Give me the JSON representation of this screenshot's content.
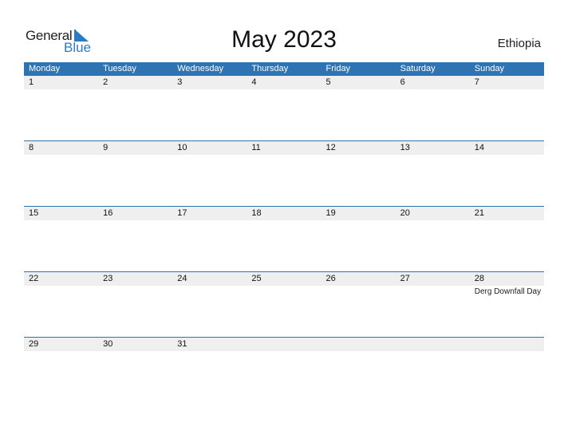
{
  "logo": {
    "general": "General",
    "blue": "Blue"
  },
  "title": "May 2023",
  "country": "Ethiopia",
  "colors": {
    "accent": "#2e73b3",
    "row_bg": "#efefef",
    "logo_blue": "#2a7bc4"
  },
  "weekdays": [
    "Monday",
    "Tuesday",
    "Wednesday",
    "Thursday",
    "Friday",
    "Saturday",
    "Sunday"
  ],
  "weeks": [
    {
      "days": [
        "1",
        "2",
        "3",
        "4",
        "5",
        "6",
        "7"
      ],
      "events": [
        "",
        "",
        "",
        "",
        "",
        "",
        ""
      ]
    },
    {
      "days": [
        "8",
        "9",
        "10",
        "11",
        "12",
        "13",
        "14"
      ],
      "events": [
        "",
        "",
        "",
        "",
        "",
        "",
        ""
      ]
    },
    {
      "days": [
        "15",
        "16",
        "17",
        "18",
        "19",
        "20",
        "21"
      ],
      "events": [
        "",
        "",
        "",
        "",
        "",
        "",
        ""
      ]
    },
    {
      "days": [
        "22",
        "23",
        "24",
        "25",
        "26",
        "27",
        "28"
      ],
      "events": [
        "",
        "",
        "",
        "",
        "",
        "",
        "Derg Downfall Day"
      ]
    },
    {
      "days": [
        "29",
        "30",
        "31",
        "",
        "",
        "",
        ""
      ],
      "events": [
        "",
        "",
        "",
        "",
        "",
        "",
        ""
      ]
    }
  ]
}
